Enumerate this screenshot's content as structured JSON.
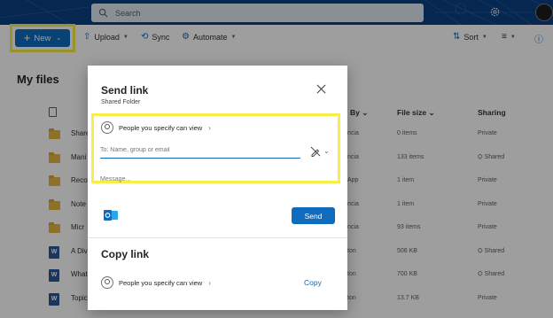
{
  "topbar": {
    "search_placeholder": "Search"
  },
  "command_bar": {
    "new_label": "New",
    "upload_label": "Upload",
    "sync_label": "Sync",
    "automate_label": "Automate",
    "sort_label": "Sort"
  },
  "page_title": "My files",
  "columns": {
    "modified_by": "By",
    "file_size": "File size",
    "sharing": "Sharing"
  },
  "rows": [
    {
      "name": "Share",
      "type": "folder",
      "modified_by": "ncia",
      "size": "0 items",
      "sharing": "Private"
    },
    {
      "name": "Mani",
      "type": "folder",
      "modified_by": "ncia",
      "size": "133 items",
      "sharing": "Shared"
    },
    {
      "name": "Reco",
      "type": "folder",
      "modified_by": "App",
      "size": "1 item",
      "sharing": "Private"
    },
    {
      "name": "Note",
      "type": "folder",
      "modified_by": "ncia",
      "size": "1 item",
      "sharing": "Private"
    },
    {
      "name": "Micr",
      "type": "folder",
      "modified_by": "ncia",
      "size": "93 items",
      "sharing": "Private"
    },
    {
      "name": "A Div",
      "type": "word",
      "modified_by": "ton",
      "size": "506 KB",
      "sharing": "Shared"
    },
    {
      "name": "What",
      "type": "word",
      "modified_by": "ton",
      "size": "700 KB",
      "sharing": "Shared"
    },
    {
      "name": "Topic",
      "type": "word",
      "modified_by": "ton",
      "size": "13.7 KB",
      "sharing": "Private"
    }
  ],
  "dialog": {
    "title": "Send link",
    "subtitle": "Shared Folder",
    "permission_label": "People you specify can view",
    "to_placeholder": "To: Name, group or email",
    "message_placeholder": "Message...",
    "send_label": "Send",
    "copy_title": "Copy link",
    "copy_permission_label": "People you specify can view",
    "copy_label": "Copy"
  },
  "colors": {
    "accent": "#0f6cbd",
    "highlight": "#f7ee4a",
    "topbar": "#0a3f82"
  }
}
